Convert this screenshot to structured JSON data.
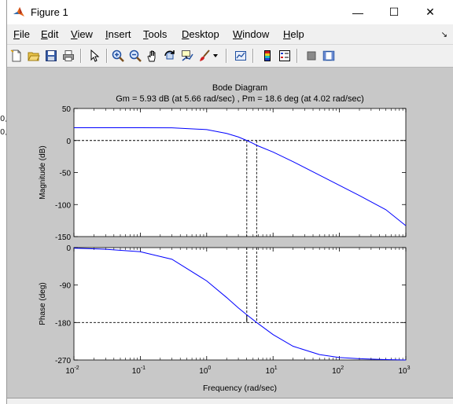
{
  "window": {
    "title": "Figure 1",
    "controls": {
      "minimize": "—",
      "maximize": "☐",
      "close": "✕"
    }
  },
  "menubar": {
    "items": [
      {
        "label": "File",
        "key": "F",
        "rest": "ile"
      },
      {
        "label": "Edit",
        "key": "E",
        "rest": "dit"
      },
      {
        "label": "View",
        "key": "V",
        "rest": "iew"
      },
      {
        "label": "Insert",
        "key": "I",
        "rest": "nsert"
      },
      {
        "label": "Tools",
        "key": "T",
        "rest": "ools"
      },
      {
        "label": "Desktop",
        "key": "D",
        "rest": "esktop"
      },
      {
        "label": "Window",
        "key": "W",
        "rest": "indow"
      },
      {
        "label": "Help",
        "key": "H",
        "rest": "elp"
      }
    ]
  },
  "toolbar": {
    "icons": [
      "new-figure-icon",
      "open-file-icon",
      "save-icon",
      "print-icon",
      "edit-plot-arrow-icon",
      "zoom-in-icon",
      "zoom-out-icon",
      "pan-hand-icon",
      "rotate-3d-icon",
      "data-cursor-icon",
      "brush-icon",
      "brush-dropdown-icon",
      "link-plot-icon",
      "colorbar-icon",
      "legend-icon",
      "hide-plot-tools-icon",
      "show-plot-tools-icon"
    ]
  },
  "background_fragments": [
    "0,",
    "0,"
  ],
  "chart_data": {
    "type": "line",
    "title": "Bode Diagram",
    "subtitle": "Gm = 5.93 dB (at 5.66 rad/sec) ,  Pm = 18.6 deg (at 4.02 rad/sec)",
    "xlabel": "Frequency  (rad/sec)",
    "xscale": "log",
    "xlim": [
      0.01,
      1000
    ],
    "xticks": [
      {
        "base": "10",
        "exp": "-2"
      },
      {
        "base": "10",
        "exp": "-1"
      },
      {
        "base": "10",
        "exp": "0"
      },
      {
        "base": "10",
        "exp": "1"
      },
      {
        "base": "10",
        "exp": "2"
      },
      {
        "base": "10",
        "exp": "3"
      }
    ],
    "magnitude": {
      "ylabel": "Magnitude (dB)",
      "ylim": [
        -150,
        50
      ],
      "yticks": [
        "50",
        "0",
        "-50",
        "-100",
        "-150"
      ],
      "series": [
        {
          "color": "#0000ff",
          "x": [
            0.01,
            0.1,
            0.3,
            1,
            2,
            3,
            4.02,
            5,
            5.66,
            10,
            20,
            50,
            100,
            200,
            500,
            1000
          ],
          "y": [
            20,
            20,
            19.8,
            17,
            11,
            5.5,
            0,
            -4.5,
            -7.5,
            -18,
            -33,
            -54,
            -70,
            -86,
            -108,
            -133
          ]
        }
      ]
    },
    "phase": {
      "ylabel": "Phase (deg)",
      "ylim": [
        -270,
        0
      ],
      "yticks": [
        "0",
        "-90",
        "-180",
        "-270"
      ],
      "series": [
        {
          "color": "#0000ff",
          "x": [
            0.01,
            0.03,
            0.1,
            0.3,
            1,
            2,
            3,
            4.02,
            5.66,
            10,
            20,
            50,
            100,
            200,
            500,
            1000
          ],
          "y": [
            -1.5,
            -4,
            -10,
            -28,
            -80,
            -120,
            -145,
            -161.4,
            -180,
            -209,
            -237,
            -257,
            -264,
            -267,
            -269,
            -270
          ]
        }
      ]
    },
    "margins": {
      "gain_margin_db": 5.93,
      "gain_crossover": 4.02,
      "phase_crossover": 5.66,
      "phase_margin_deg": 18.6
    },
    "grid": false
  }
}
